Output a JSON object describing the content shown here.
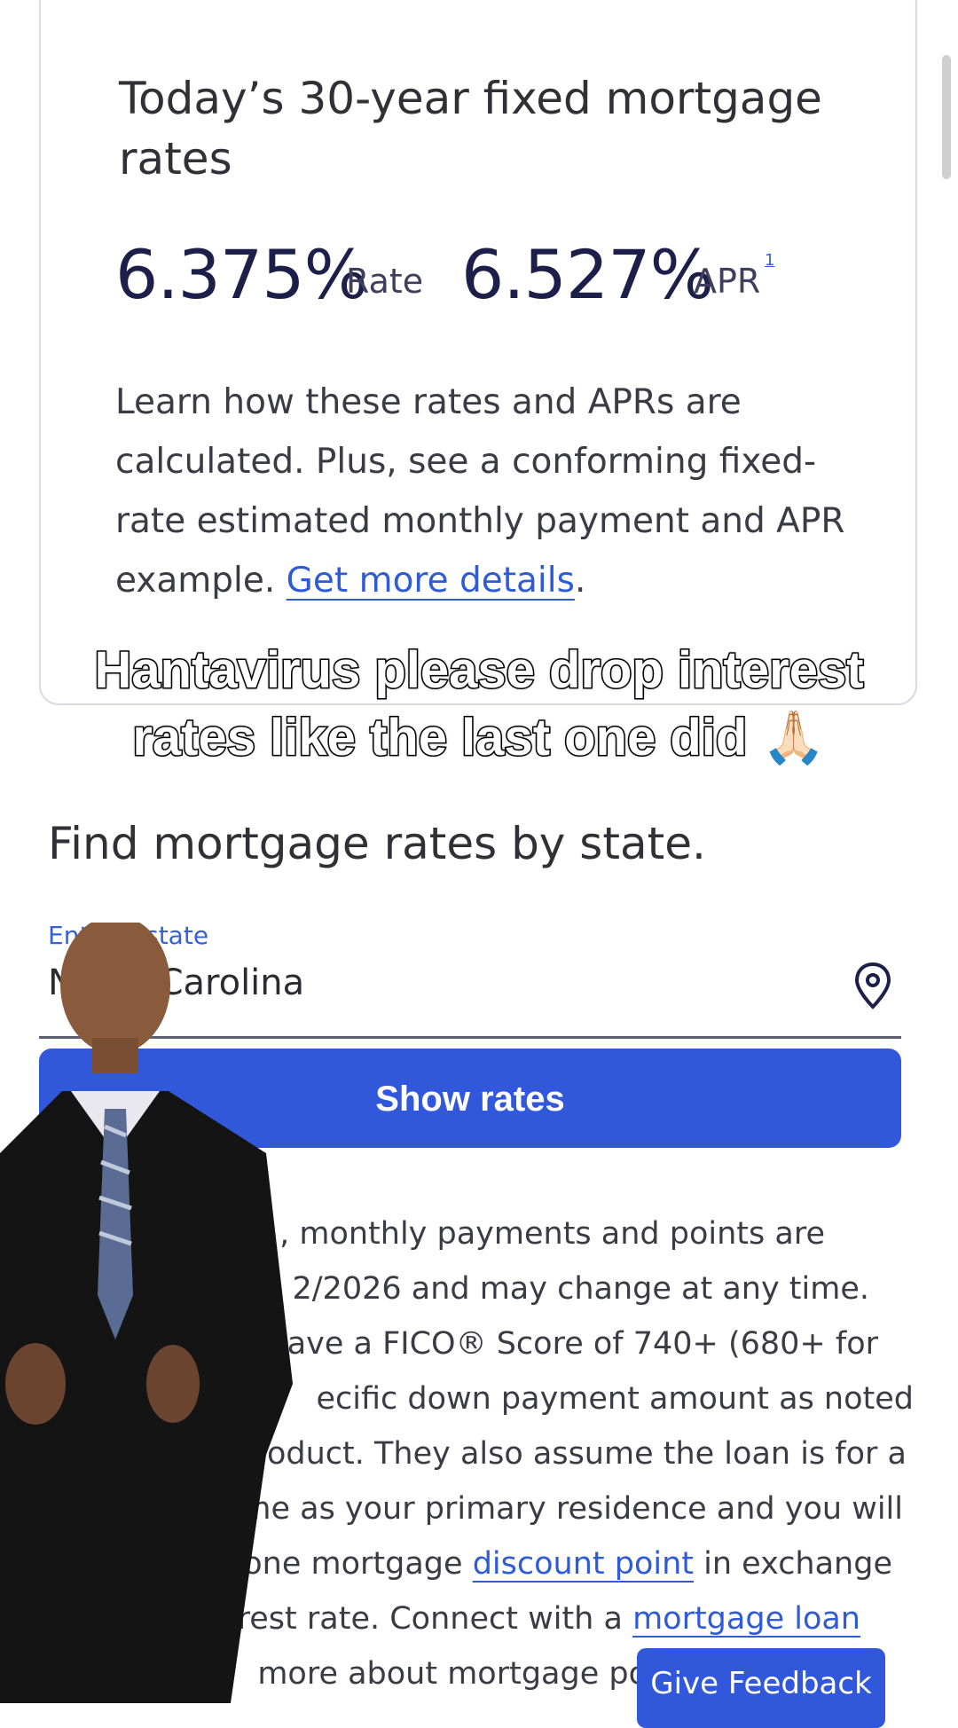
{
  "card": {
    "title": "Today’s 30-year fixed mortgage rates",
    "rate_value": "6.375%",
    "rate_label": "Rate",
    "apr_value": "6.527%",
    "apr_label": "APR",
    "apr_footnote": "1",
    "learn_text": "Learn how these rates and APRs are calculated. Plus, see a conforming fixed-rate estimated monthly payment and APR example.",
    "details_link": "Get more details",
    "period": "."
  },
  "caption": {
    "text": "Hantavirus please drop interest rates like the last one did",
    "emoji": "🙏🏻"
  },
  "find": {
    "title": "Find mortgage rates by state.",
    "state_label": "Enter a state",
    "state_value": "North Carolina",
    "show_button": "Show rates"
  },
  "disclaimer": {
    "line1": ", monthly payments and points are",
    "line2": "2/2026 and may change at any time.",
    "line3": "ave a FICO® Score of 740+ (680+ for",
    "line4": "ecific down payment amount as noted",
    "line5": "oduct. They also assume the loan is for a",
    "line6": "home as your primary residence and you will",
    "line7_a": "one mortgage",
    "line7_link": "discount point",
    "line7_b": "in exchange",
    "line8_a": "rest rate. Connect with a",
    "line8_link": "mortgage loan",
    "line9": "more about mortgage po"
  },
  "feedback": {
    "label": "Give Feedback"
  },
  "colors": {
    "brand_blue": "#3158da",
    "link_blue": "#2f5bd7",
    "rate_navy": "#1c1f4a"
  }
}
